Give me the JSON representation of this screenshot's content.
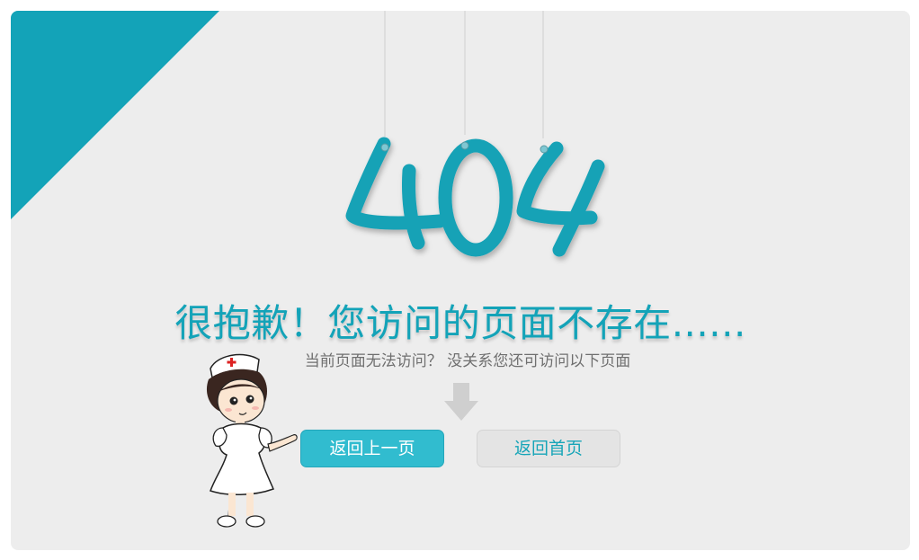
{
  "error_code": "404",
  "headline": "很抱歉！您访问的页面不存在......",
  "subline": "当前页面无法访问？ 没关系您还可访问以下页面",
  "buttons": {
    "back_label": "返回上一页",
    "home_label": "返回首页"
  },
  "colors": {
    "accent": "#13a3b8",
    "button_primary": "#31bccf",
    "button_secondary": "#e4e4e4",
    "card_background": "#ededed"
  },
  "icons": {
    "arrow": "down-arrow-icon",
    "illustration": "nurse-illustration",
    "corner": "corner-triangle-decoration"
  }
}
